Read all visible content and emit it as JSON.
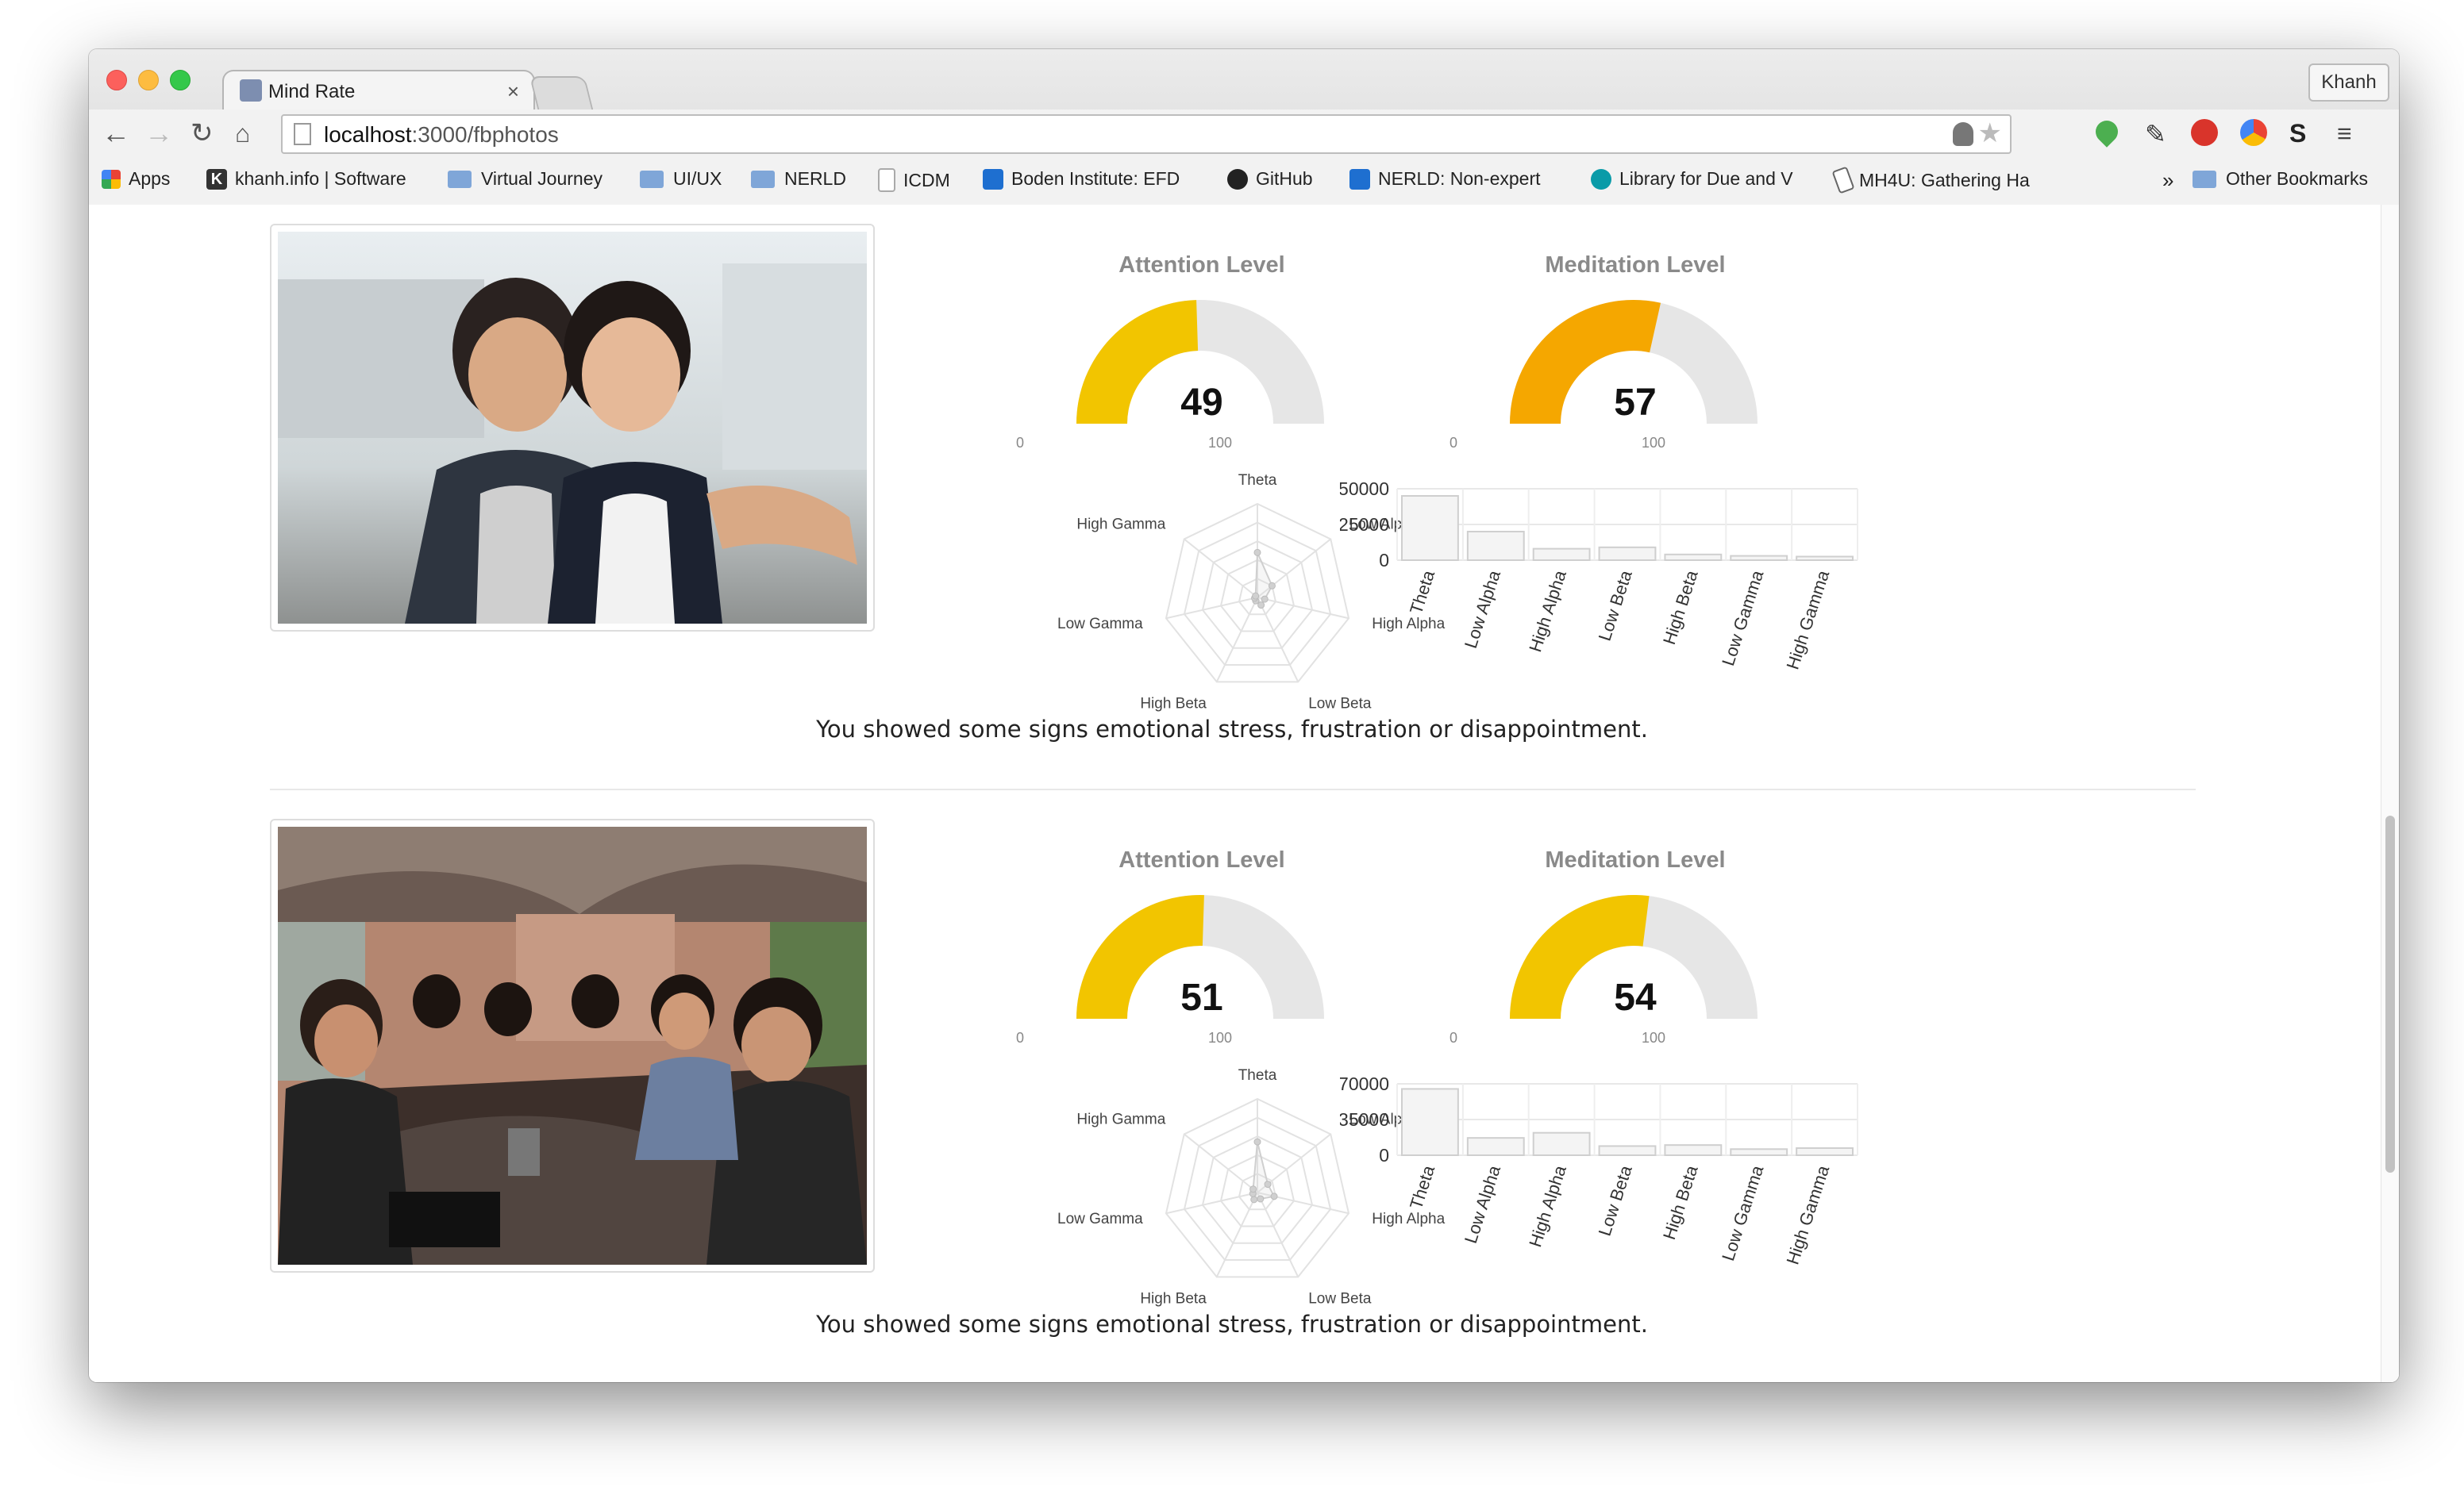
{
  "browser": {
    "tab_title": "Mind Rate",
    "tab_close": "×",
    "profile": "Khanh",
    "url_host": "localhost",
    "url_path": ":3000/fbphotos",
    "bookmarks": [
      {
        "label": "Apps"
      },
      {
        "label": "khanh.info | Software"
      },
      {
        "label": "Virtual Journey"
      },
      {
        "label": "UI/UX"
      },
      {
        "label": "NERLD"
      },
      {
        "label": "ICDM"
      },
      {
        "label": "Boden Institute: EFD"
      },
      {
        "label": "GitHub"
      },
      {
        "label": "NERLD: Non-expert"
      },
      {
        "label": "Library for Due and V"
      },
      {
        "label": "MH4U: Gathering Ha"
      }
    ],
    "overflow": "»",
    "other_bookmarks": "Other Bookmarks"
  },
  "accent_colors": {
    "gauge_yellow": "#f2c500",
    "gauge_orange": "#f5a700",
    "gauge_track": "#e6e6e6"
  },
  "entries": [
    {
      "attention_title": "Attention Level",
      "attention_value": "49",
      "meditation_title": "Meditation Level",
      "meditation_value": "57",
      "gauge_min": "0",
      "gauge_max": "100",
      "message": "You showed some signs emotional stress, frustration or disappointment."
    },
    {
      "attention_title": "Attention Level",
      "attention_value": "51",
      "meditation_title": "Meditation Level",
      "meditation_value": "54",
      "gauge_min": "0",
      "gauge_max": "100",
      "message": "You showed some signs emotional stress, frustration or disappointment."
    }
  ],
  "chart_data": [
    {
      "type": "gauge",
      "title": "Attention Level",
      "value": 49,
      "range": [
        0,
        100
      ]
    },
    {
      "type": "gauge",
      "title": "Meditation Level",
      "value": 57,
      "range": [
        0,
        100
      ]
    },
    {
      "type": "radar",
      "categories": [
        "Theta",
        "Low Alpha",
        "High Alpha",
        "Low Beta",
        "High Beta",
        "Low Gamma",
        "High Gamma"
      ],
      "values": [
        48000,
        20000,
        8000,
        9000,
        4000,
        3000,
        2500
      ],
      "max": 100000
    },
    {
      "type": "bar",
      "categories": [
        "Theta",
        "Low Alpha",
        "High Alpha",
        "Low Beta",
        "High Beta",
        "Low Gamma",
        "High Gamma"
      ],
      "values": [
        45000,
        20000,
        8000,
        9000,
        4000,
        3000,
        2500
      ],
      "yticks": [
        "50000",
        "25000",
        "0"
      ],
      "ylim": [
        0,
        50000
      ]
    },
    {
      "type": "gauge",
      "title": "Attention Level",
      "value": 51,
      "range": [
        0,
        100
      ]
    },
    {
      "type": "gauge",
      "title": "Meditation Level",
      "value": 54,
      "range": [
        0,
        100
      ]
    },
    {
      "type": "radar",
      "categories": [
        "Theta",
        "Low Alpha",
        "High Alpha",
        "Low Beta",
        "High Beta",
        "Low Gamma",
        "High Gamma"
      ],
      "values": [
        65000,
        17000,
        22000,
        9000,
        10000,
        6000,
        7000
      ],
      "max": 120000
    },
    {
      "type": "bar",
      "categories": [
        "Theta",
        "Low Alpha",
        "High Alpha",
        "Low Beta",
        "High Beta",
        "Low Gamma",
        "High Gamma"
      ],
      "values": [
        65000,
        17000,
        22000,
        9000,
        10000,
        6000,
        7000
      ],
      "yticks": [
        "70000",
        "35000",
        "0"
      ],
      "ylim": [
        0,
        70000
      ]
    }
  ]
}
